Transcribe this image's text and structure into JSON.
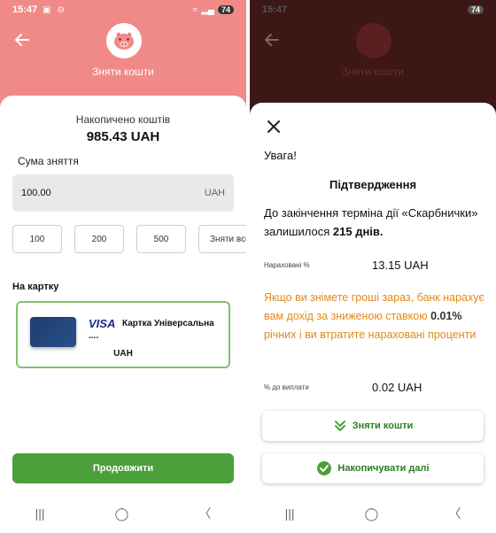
{
  "status": {
    "time": "15:47",
    "battery": "74"
  },
  "left": {
    "header_title": "Зняти кошти",
    "accumulated_label": "Накопичено коштів",
    "accumulated_amount": "985.43 UAH",
    "sum_label": "Сума зняття",
    "amount_value": "100.00",
    "amount_currency": "UAH",
    "chips": [
      "100",
      "200",
      "500",
      "Зняти все"
    ],
    "to_card_label": "На картку",
    "card": {
      "brand": "VISA",
      "name": "Картка Універсальна",
      "masked": "....",
      "currency": "UAH"
    },
    "continue_label": "Продовжити"
  },
  "right": {
    "warning": "Увага!",
    "confirm_title": "Підтвердження",
    "term_prefix": "До закінчення терміна дії «Скарбнички» залишилося",
    "term_days": "215",
    "term_suffix": "днів.",
    "accrued_label": "Нараховані %",
    "accrued_value": "13.15 UAH",
    "notice_part1": "Якщо ви знімете гроші зараз, банк нарахує вам дохід за зниженою ставкою",
    "notice_rate": "0.01%",
    "notice_part2": "річних і ви втратите нараховані проценти",
    "payout_label": "% до виплати",
    "payout_value": "0.02 UAH",
    "withdraw_label": "Зняти кошти",
    "keep_label": "Накопичувати далі"
  },
  "colors": {
    "header": "#f08a89",
    "accent_green": "#4ba03b",
    "warning_orange": "#e08a18"
  },
  "icons": [
    "back-arrow-icon",
    "pig-icon",
    "close-icon",
    "double-chevron-down-icon",
    "check-circle-icon",
    "nav-recents-icon",
    "nav-home-icon",
    "nav-back-icon"
  ]
}
